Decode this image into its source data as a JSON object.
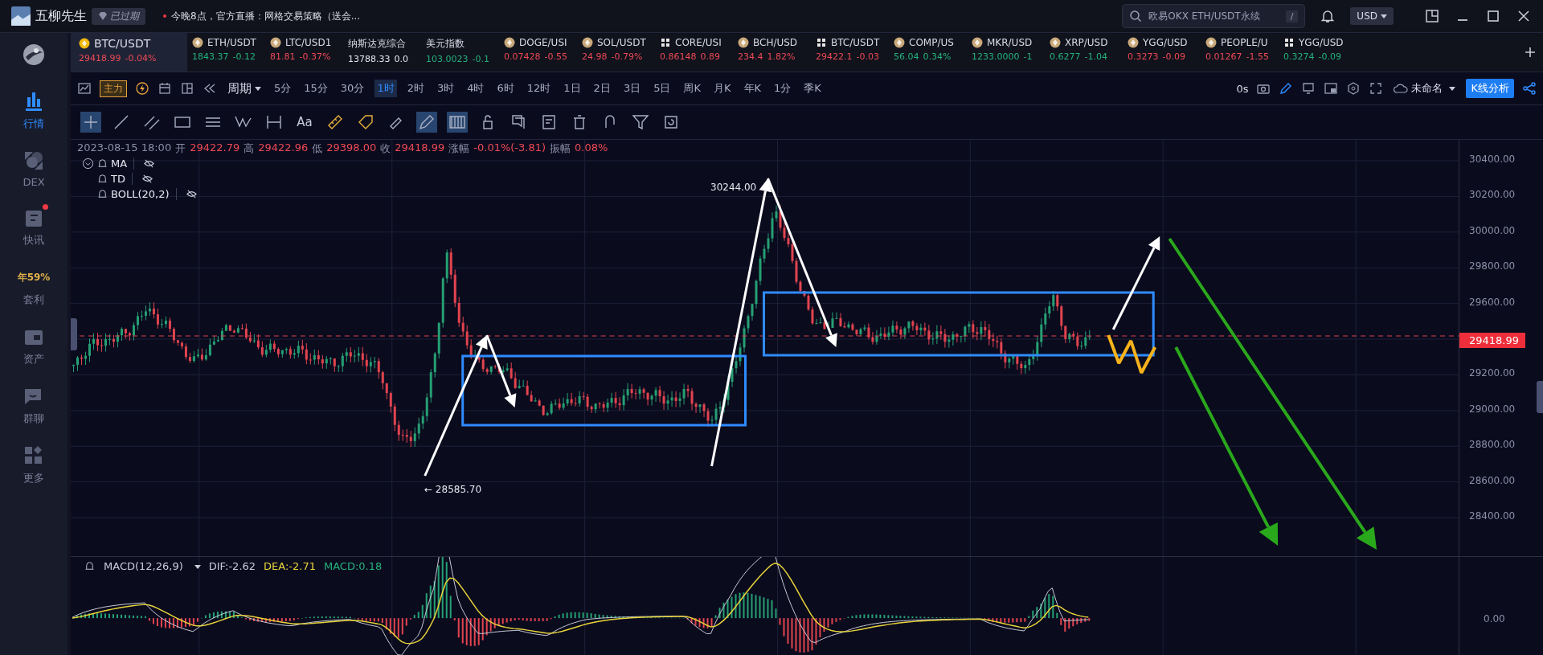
{
  "top_bar": {
    "app_name": "五柳先生",
    "badge": "已过期",
    "notice": "今晚8点，官方直播：网格交易策略（送会...",
    "search": {
      "placeholder": "欧易OKX ETH/USDT永续",
      "shortcut": "/"
    },
    "currency": "USD"
  },
  "sidebar": {
    "items": [
      {
        "kind": "market",
        "label": "行情",
        "selected": true,
        "dot": false
      },
      {
        "kind": "dex",
        "label": "DEX",
        "selected": false,
        "dot": false
      },
      {
        "kind": "news",
        "label": "快讯",
        "selected": false,
        "dot": true
      },
      {
        "kind": "yield",
        "highlight": "年59%",
        "label": "套利",
        "selected": false,
        "dot": false
      },
      {
        "kind": "wallet",
        "label": "资产",
        "selected": false,
        "dot": false
      },
      {
        "kind": "chat",
        "label": "群聊",
        "selected": false,
        "dot": false
      },
      {
        "kind": "more",
        "label": "更多",
        "selected": false,
        "dot": false
      }
    ]
  },
  "tickers": [
    {
      "kind": "coin",
      "symbol": "BTC/USDT",
      "price": "29418.99",
      "change": "-0.04%",
      "up": false,
      "selected": true
    },
    {
      "kind": "coin",
      "symbol": "ETH/USDT",
      "price": "1843.37",
      "change": "-0.12",
      "up": true,
      "selected": false
    },
    {
      "kind": "coin",
      "symbol": "LTC/USD1",
      "price": "81.81",
      "change": "-0.37%",
      "up": false,
      "selected": false
    },
    {
      "kind": "none",
      "symbol": "纳斯达克综合",
      "price": "13788.33",
      "change": "0.0",
      "selected": false
    },
    {
      "kind": "none",
      "symbol": "美元指数",
      "price": "103.0023",
      "change": "-0.1",
      "up": true,
      "selected": false
    },
    {
      "kind": "coin",
      "symbol": "DOGE/USI",
      "price": "0.07428",
      "change": "-0.55",
      "up": false,
      "selected": false
    },
    {
      "kind": "coin",
      "symbol": "SOL/USDT",
      "price": "24.98",
      "change": "-0.79%",
      "up": false,
      "selected": false
    },
    {
      "kind": "grid",
      "symbol": "CORE/USI",
      "price": "0.86148",
      "change": "0.89",
      "up": false,
      "selected": false
    },
    {
      "kind": "coin",
      "symbol": "BCH/USD",
      "price": "234.4",
      "change": "1.82%",
      "up": false,
      "selected": false
    },
    {
      "kind": "grid",
      "symbol": "BTC/USDT",
      "price": "29422.1",
      "change": "-0.03",
      "up": false,
      "selected": false
    },
    {
      "kind": "coin",
      "symbol": "COMP/US",
      "price": "56.04",
      "change": "0.34%",
      "up": true,
      "selected": false
    },
    {
      "kind": "coin",
      "symbol": "MKR/USD",
      "price": "1233.0000",
      "change": "-1",
      "up": true,
      "selected": false
    },
    {
      "kind": "coin",
      "symbol": "XRP/USD",
      "price": "0.6277",
      "change": "-1.04",
      "up": true,
      "selected": false
    },
    {
      "kind": "coin",
      "symbol": "YGG/USD",
      "price": "0.3273",
      "change": "-0.09",
      "up": false,
      "selected": false
    },
    {
      "kind": "coin",
      "symbol": "PEOPLE/U",
      "price": "0.01267",
      "change": "-1.55",
      "up": false,
      "selected": false
    },
    {
      "kind": "grid",
      "symbol": "YGG/USD",
      "price": "0.3274",
      "change": "-0.09",
      "up": true,
      "selected": false
    }
  ],
  "toolbar": {
    "main_button": "主力",
    "period_menu": "周期",
    "periods": [
      {
        "label": "5分",
        "selected": false
      },
      {
        "label": "15分",
        "selected": false
      },
      {
        "label": "30分",
        "selected": false
      },
      {
        "label": "1时",
        "selected": true
      },
      {
        "label": "2时",
        "selected": false
      },
      {
        "label": "3时",
        "selected": false
      },
      {
        "label": "4时",
        "selected": false
      },
      {
        "label": "6时",
        "selected": false
      },
      {
        "label": "12时",
        "selected": false
      },
      {
        "label": "1日",
        "selected": false
      },
      {
        "label": "2日",
        "selected": false
      },
      {
        "label": "3日",
        "selected": false
      },
      {
        "label": "5日",
        "selected": false
      },
      {
        "label": "周K",
        "selected": false
      },
      {
        "label": "月K",
        "selected": false
      },
      {
        "label": "年K",
        "selected": false
      },
      {
        "label": "1分",
        "selected": false
      },
      {
        "label": "季K",
        "selected": false
      }
    ],
    "countdown": "0s",
    "layout_name": "未命名",
    "analysis_button": "K线分析"
  },
  "drawing_tools": [
    {
      "kind": "crosshair",
      "selected": true
    },
    {
      "kind": "line",
      "selected": false
    },
    {
      "kind": "parallel",
      "selected": false
    },
    {
      "kind": "rect",
      "selected": false
    },
    {
      "kind": "fib",
      "selected": false
    },
    {
      "kind": "wave",
      "selected": false
    },
    {
      "kind": "measure",
      "selected": false
    },
    {
      "kind": "text",
      "label": "Aa",
      "selected": false
    },
    {
      "kind": "ruler-yellow",
      "selected": false
    },
    {
      "kind": "tag-yellow",
      "selected": false
    },
    {
      "kind": "ruler",
      "selected": false
    },
    {
      "kind": "pen",
      "selected": true
    },
    {
      "kind": "bars",
      "selected": true
    },
    {
      "kind": "lock",
      "selected": false
    },
    {
      "kind": "layers",
      "selected": false
    },
    {
      "kind": "note",
      "selected": false
    },
    {
      "kind": "trash",
      "selected": false
    },
    {
      "kind": "magnet",
      "selected": false
    },
    {
      "kind": "filter",
      "selected": false
    },
    {
      "kind": "refresh",
      "selected": false
    }
  ],
  "ohlc": {
    "time": "2023-08-15 18:00",
    "items": [
      {
        "label": "开",
        "value": "29422.79"
      },
      {
        "label": "高",
        "value": "29422.96"
      },
      {
        "label": "低",
        "value": "29398.00"
      },
      {
        "label": "收",
        "value": "29418.99"
      },
      {
        "label": "涨幅",
        "value": "-0.01%(-3.81)"
      },
      {
        "label": "振幅",
        "value": "0.08%"
      }
    ]
  },
  "indicators": [
    {
      "name": "MA",
      "collapse": true
    },
    {
      "name": "TD",
      "collapse": false
    },
    {
      "name": "BOLL(20,2)",
      "collapse": false
    }
  ],
  "chart": {
    "high_label": "30244.00",
    "low_label": "← 28585.70",
    "last_price": "29418.99",
    "price_ticks": [
      "30400.00",
      "30200.00",
      "30000.00",
      "29800.00",
      "29600.00",
      "29200.00",
      "29000.00",
      "28800.00",
      "28600.00",
      "28400.00"
    ]
  },
  "macd": {
    "name": "MACD(12,26,9)",
    "dif": "DIF:-2.62",
    "dea": "DEA:-2.71",
    "value": "MACD:0.18",
    "zero_tick": "0.00"
  }
}
